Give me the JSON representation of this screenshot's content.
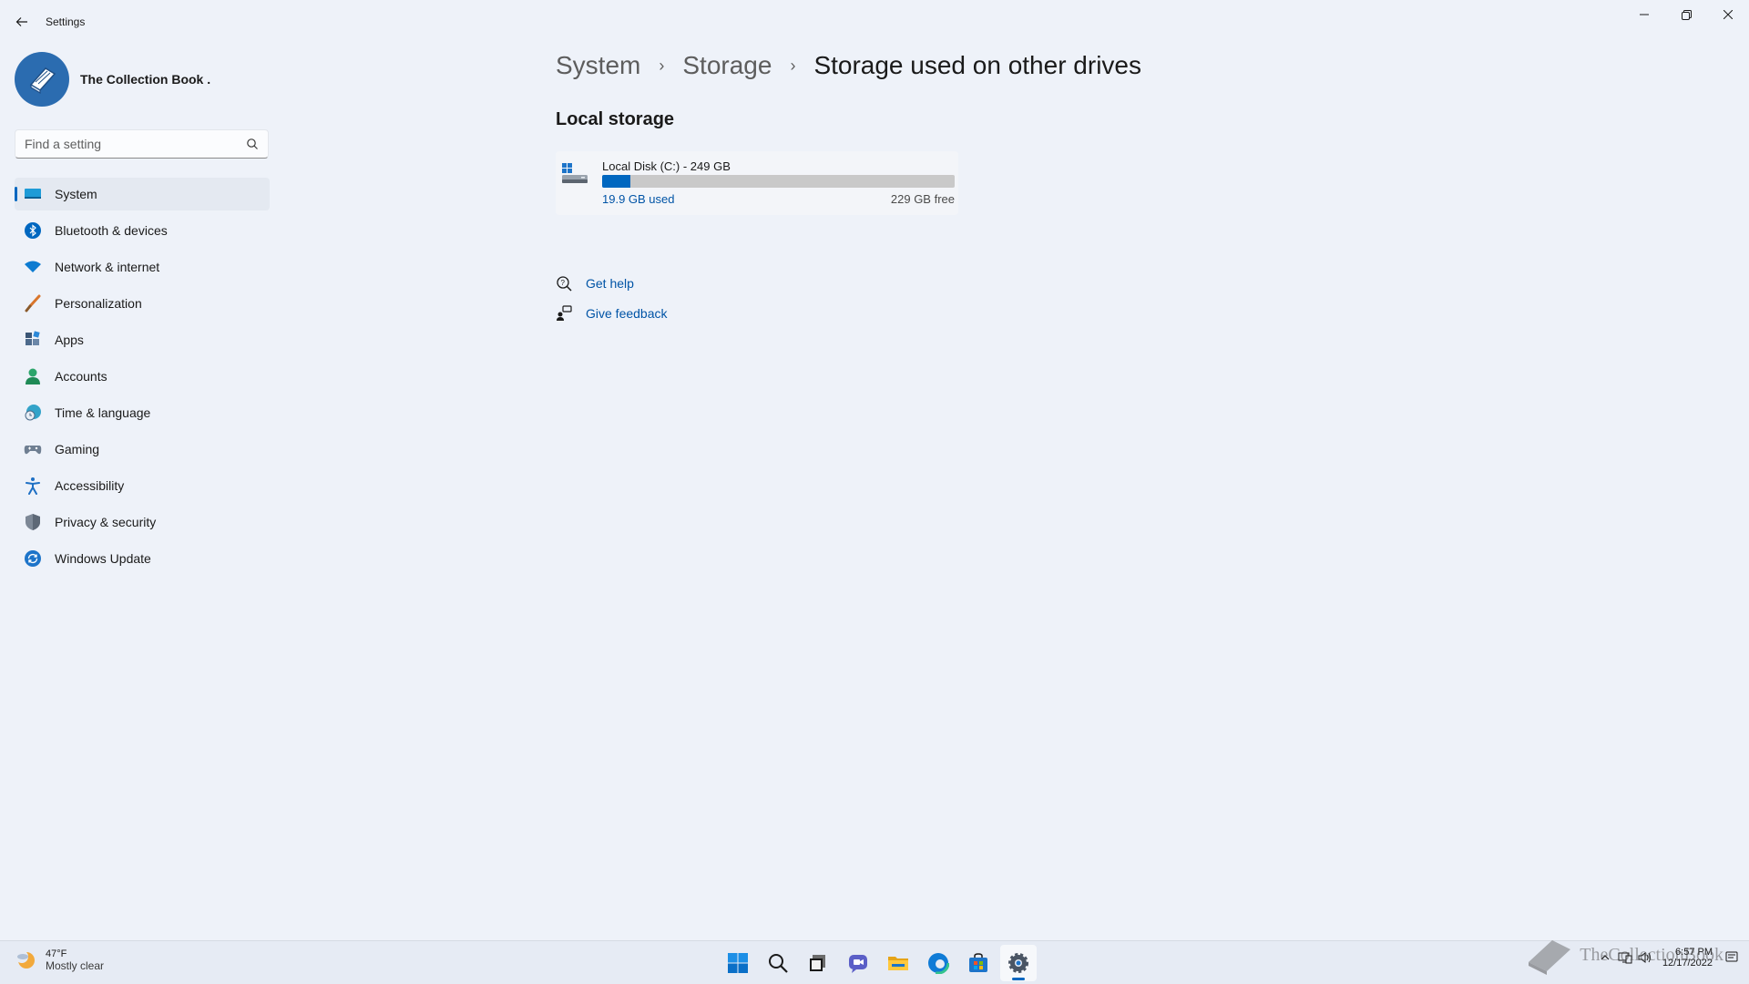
{
  "window": {
    "title": "Settings"
  },
  "profile": {
    "name": "The Collection Book ."
  },
  "search": {
    "placeholder": "Find a setting"
  },
  "sidebar": {
    "items": [
      {
        "label": "System",
        "icon": "system-icon",
        "active": true
      },
      {
        "label": "Bluetooth & devices",
        "icon": "bluetooth-icon"
      },
      {
        "label": "Network & internet",
        "icon": "wifi-icon"
      },
      {
        "label": "Personalization",
        "icon": "brush-icon"
      },
      {
        "label": "Apps",
        "icon": "apps-icon"
      },
      {
        "label": "Accounts",
        "icon": "person-icon"
      },
      {
        "label": "Time & language",
        "icon": "globe-clock-icon"
      },
      {
        "label": "Gaming",
        "icon": "gamepad-icon"
      },
      {
        "label": "Accessibility",
        "icon": "accessibility-icon"
      },
      {
        "label": "Privacy & security",
        "icon": "shield-icon"
      },
      {
        "label": "Windows Update",
        "icon": "update-icon"
      }
    ]
  },
  "breadcrumb": {
    "items": [
      "System",
      "Storage",
      "Storage used on other drives"
    ]
  },
  "main": {
    "section_title": "Local storage",
    "disk": {
      "name": "Local Disk (C:) - 249 GB",
      "used": "19.9 GB used",
      "free": "229 GB free",
      "used_fraction": 0.08
    },
    "links": {
      "get_help": "Get help",
      "give_feedback": "Give feedback"
    }
  },
  "taskbar": {
    "weather_temp": "47°F",
    "weather_condition": "Mostly clear",
    "apps": [
      "start-icon",
      "search-icon",
      "task-view-icon",
      "chat-icon",
      "file-explorer-icon",
      "edge-icon",
      "store-icon",
      "settings-icon"
    ],
    "time": "6:57 PM",
    "date": "12/17/2022"
  },
  "watermark": {
    "text": "TheCollectionBook"
  },
  "colors": {
    "accent": "#0067c0",
    "link": "#0054a6",
    "background": "#eef2f9"
  }
}
